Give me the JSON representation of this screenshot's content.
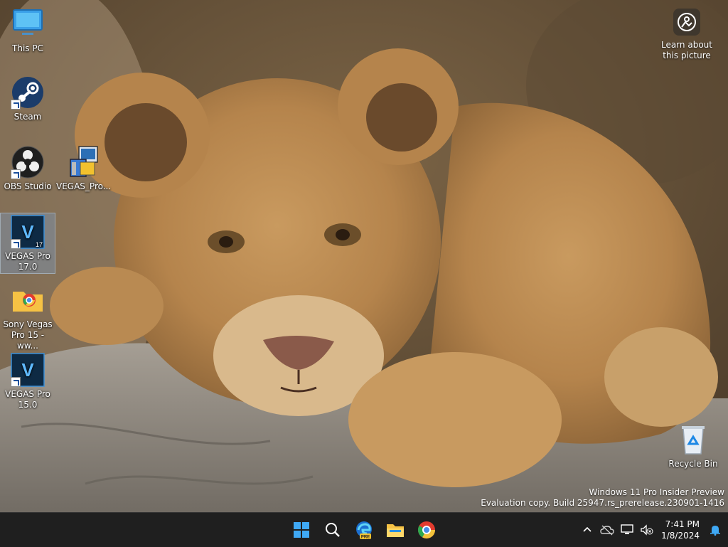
{
  "desktop": {
    "icons": [
      {
        "label": "This PC",
        "icon": "monitor-icon"
      },
      {
        "label": "Steam",
        "icon": "steam-icon"
      },
      {
        "label": "OBS Studio",
        "icon": "obs-icon"
      },
      {
        "label": "VEGAS_Pro...",
        "icon": "installer-icon"
      },
      {
        "label": "VEGAS Pro\n17.0",
        "icon": "vegas-icon",
        "badge": "17"
      },
      {
        "label": "Sony Vegas\nPro 15 - ww...",
        "icon": "folder-chrome-icon"
      },
      {
        "label": "VEGAS Pro\n15.0",
        "icon": "vegas-icon",
        "badge": ""
      },
      {
        "label": "Recycle Bin",
        "icon": "recycle-bin-icon"
      }
    ],
    "vegas_letter": "V",
    "learn": {
      "label": "Learn about\nthis picture"
    },
    "watermark": {
      "line1": "Windows 11 Pro Insider Preview",
      "line2": "Evaluation copy. Build 25947.rs_prerelease.230901-1416"
    }
  },
  "taskbar": {
    "pinned": [
      {
        "name": "start",
        "icon": "windows-start-icon"
      },
      {
        "name": "search",
        "icon": "search-icon"
      },
      {
        "name": "edge-beta",
        "icon": "edge-icon",
        "badge": "PRE"
      },
      {
        "name": "file-explorer",
        "icon": "folder-icon"
      },
      {
        "name": "chrome",
        "icon": "chrome-icon"
      }
    ],
    "tray": {
      "time": "7:41 PM",
      "date": "1/8/2024"
    }
  },
  "colors": {
    "taskbar_bg": "#1f1f1f",
    "accent": "#0078d4",
    "vegas_bg": "#0e2a44"
  }
}
